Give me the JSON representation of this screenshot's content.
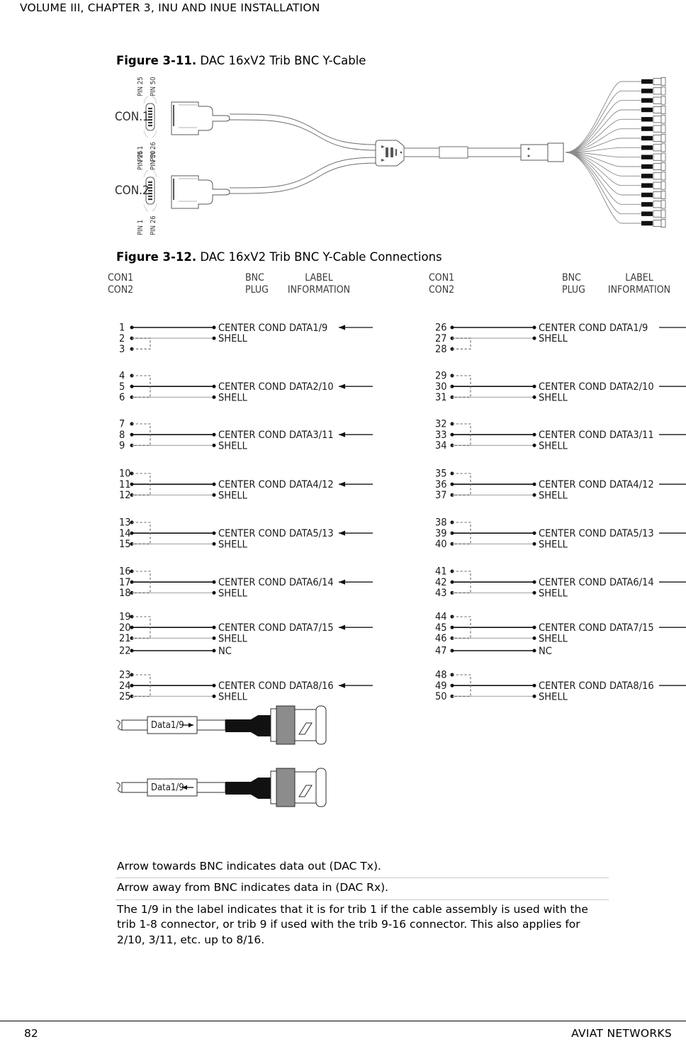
{
  "header": {
    "running_head": "VOLUME III, CHAPTER 3, INU AND INUE INSTALLATION"
  },
  "figure_311": {
    "caption_number": "Figure 3-11.",
    "caption_text": " DAC 16xV2 Trib BNC Y-Cable",
    "connectors": [
      {
        "name": "CON.1",
        "top_left_pin": "PIN 25",
        "top_right_pin": "PIN 50",
        "bottom_left_pin": "PIN 1",
        "bottom_right_pin": "PIN 26"
      },
      {
        "name": "CON.2",
        "top_left_pin": "PIN 25",
        "top_right_pin": "PIN 50",
        "bottom_left_pin": "PIN 1",
        "bottom_right_pin": "PIN 26"
      }
    ],
    "bnc_fanout_count": 16
  },
  "figure_312": {
    "caption_number": "Figure 3-12.",
    "caption_text": " DAC 16xV2 Trib BNC Y-Cable Connections",
    "columns": [
      {
        "header_line1": "CON1",
        "header_line2": "CON2"
      },
      {
        "header_line1": "BNC",
        "header_line2": "PLUG"
      },
      {
        "header_line1": "LABEL",
        "header_line2": "INFORMATION"
      },
      {
        "header_line1": "CON1",
        "header_line2": "CON2"
      },
      {
        "header_line1": "BNC",
        "header_line2": "PLUG"
      },
      {
        "header_line1": "LABEL",
        "header_line2": "INFORMATION"
      }
    ],
    "left_block": {
      "arrow_direction": "left",
      "groups": [
        {
          "pins": [
            "1",
            "2",
            "3"
          ],
          "center_cond_pin": "1",
          "shell_pin": "2",
          "bridge_pins": [
            "2",
            "3"
          ],
          "bnc_labels": [
            "CENTER COND",
            "SHELL"
          ],
          "label": "DATA1/9"
        },
        {
          "pins": [
            "4",
            "5",
            "6"
          ],
          "center_cond_pin": "5",
          "shell_pin": "6",
          "bridge_pins": [
            "4",
            "6"
          ],
          "bnc_labels": [
            "CENTER COND",
            "SHELL"
          ],
          "label": "DATA2/10"
        },
        {
          "pins": [
            "7",
            "8",
            "9"
          ],
          "center_cond_pin": "8",
          "shell_pin": "9",
          "bridge_pins": [
            "7",
            "9"
          ],
          "bnc_labels": [
            "CENTER COND",
            "SHELL"
          ],
          "label": "DATA3/11"
        },
        {
          "pins": [
            "10",
            "11",
            "12"
          ],
          "center_cond_pin": "11",
          "shell_pin": "12",
          "bridge_pins": [
            "10",
            "12"
          ],
          "bnc_labels": [
            "CENTER COND",
            "SHELL"
          ],
          "label": "DATA4/12"
        },
        {
          "pins": [
            "13",
            "14",
            "15"
          ],
          "center_cond_pin": "14",
          "shell_pin": "15",
          "bridge_pins": [
            "13",
            "15"
          ],
          "bnc_labels": [
            "CENTER COND",
            "SHELL"
          ],
          "label": "DATA5/13"
        },
        {
          "pins": [
            "16",
            "17",
            "18"
          ],
          "center_cond_pin": "17",
          "shell_pin": "18",
          "bridge_pins": [
            "16",
            "18"
          ],
          "bnc_labels": [
            "CENTER COND",
            "SHELL"
          ],
          "label": "DATA6/14"
        },
        {
          "pins": [
            "19",
            "20",
            "21"
          ],
          "center_cond_pin": "20",
          "shell_pin": "21",
          "bridge_pins": [
            "19",
            "21"
          ],
          "bnc_labels": [
            "CENTER COND",
            "SHELL"
          ],
          "label": "DATA7/15"
        },
        {
          "pins": [
            "22"
          ],
          "center_cond_pin": "22",
          "shell_pin": null,
          "bridge_pins": [],
          "bnc_labels": [
            "NC"
          ],
          "label": ""
        },
        {
          "pins": [
            "23",
            "24",
            "25"
          ],
          "center_cond_pin": "24",
          "shell_pin": "25",
          "bridge_pins": [
            "23",
            "25"
          ],
          "bnc_labels": [
            "CENTER COND",
            "SHELL"
          ],
          "label": "DATA8/16"
        }
      ]
    },
    "right_block": {
      "arrow_direction": "right",
      "groups": [
        {
          "pins": [
            "26",
            "27",
            "28"
          ],
          "center_cond_pin": "26",
          "shell_pin": "27",
          "bridge_pins": [
            "27",
            "28"
          ],
          "bnc_labels": [
            "CENTER COND",
            "SHELL"
          ],
          "label": "DATA1/9"
        },
        {
          "pins": [
            "29",
            "30",
            "31"
          ],
          "center_cond_pin": "30",
          "shell_pin": "31",
          "bridge_pins": [
            "29",
            "31"
          ],
          "bnc_labels": [
            "CENTER COND",
            "SHELL"
          ],
          "label": "DATA2/10"
        },
        {
          "pins": [
            "32",
            "33",
            "34"
          ],
          "center_cond_pin": "33",
          "shell_pin": "34",
          "bridge_pins": [
            "32",
            "34"
          ],
          "bnc_labels": [
            "CENTER COND",
            "SHELL"
          ],
          "label": "DATA3/11"
        },
        {
          "pins": [
            "35",
            "36",
            "37"
          ],
          "center_cond_pin": "36",
          "shell_pin": "37",
          "bridge_pins": [
            "35",
            "37"
          ],
          "bnc_labels": [
            "CENTER COND",
            "SHELL"
          ],
          "label": "DATA4/12"
        },
        {
          "pins": [
            "38",
            "39",
            "40"
          ],
          "center_cond_pin": "39",
          "shell_pin": "40",
          "bridge_pins": [
            "38",
            "40"
          ],
          "bnc_labels": [
            "CENTER COND",
            "SHELL"
          ],
          "label": "DATA5/13"
        },
        {
          "pins": [
            "41",
            "42",
            "43"
          ],
          "center_cond_pin": "42",
          "shell_pin": "43",
          "bridge_pins": [
            "41",
            "43"
          ],
          "bnc_labels": [
            "CENTER COND",
            "SHELL"
          ],
          "label": "DATA6/14"
        },
        {
          "pins": [
            "44",
            "45",
            "46"
          ],
          "center_cond_pin": "45",
          "shell_pin": "46",
          "bridge_pins": [
            "44",
            "46"
          ],
          "bnc_labels": [
            "CENTER COND",
            "SHELL"
          ],
          "label": "DATA7/15"
        },
        {
          "pins": [
            "47"
          ],
          "center_cond_pin": "47",
          "shell_pin": null,
          "bridge_pins": [],
          "bnc_labels": [
            "NC"
          ],
          "label": ""
        },
        {
          "pins": [
            "48",
            "49",
            "50"
          ],
          "center_cond_pin": "49",
          "shell_pin": "50",
          "bridge_pins": [
            "48",
            "50"
          ],
          "bnc_labels": [
            "CENTER  COND",
            "SHELL"
          ],
          "label": "DATA8/16"
        }
      ]
    },
    "bnc_detail": [
      {
        "label": "Data1/9",
        "arrow_direction": "toward-bnc"
      },
      {
        "label": "Data1/9",
        "arrow_direction": "away-from-bnc"
      }
    ]
  },
  "notes": [
    "Arrow towards BNC indicates data out (DAC Tx).",
    "Arrow away from BNC indicates data in (DAC Rx).",
    "The 1/9 in the label indicates that it is for trib 1 if the cable assembly is used with the trib 1-8 connector, or trib 9 if used with the trib 9-16 connector. This also applies for 2/10, 3/11, etc. up to 8/16."
  ],
  "footer": {
    "page_number": "82",
    "company": "AVIAT NETWORKS"
  }
}
